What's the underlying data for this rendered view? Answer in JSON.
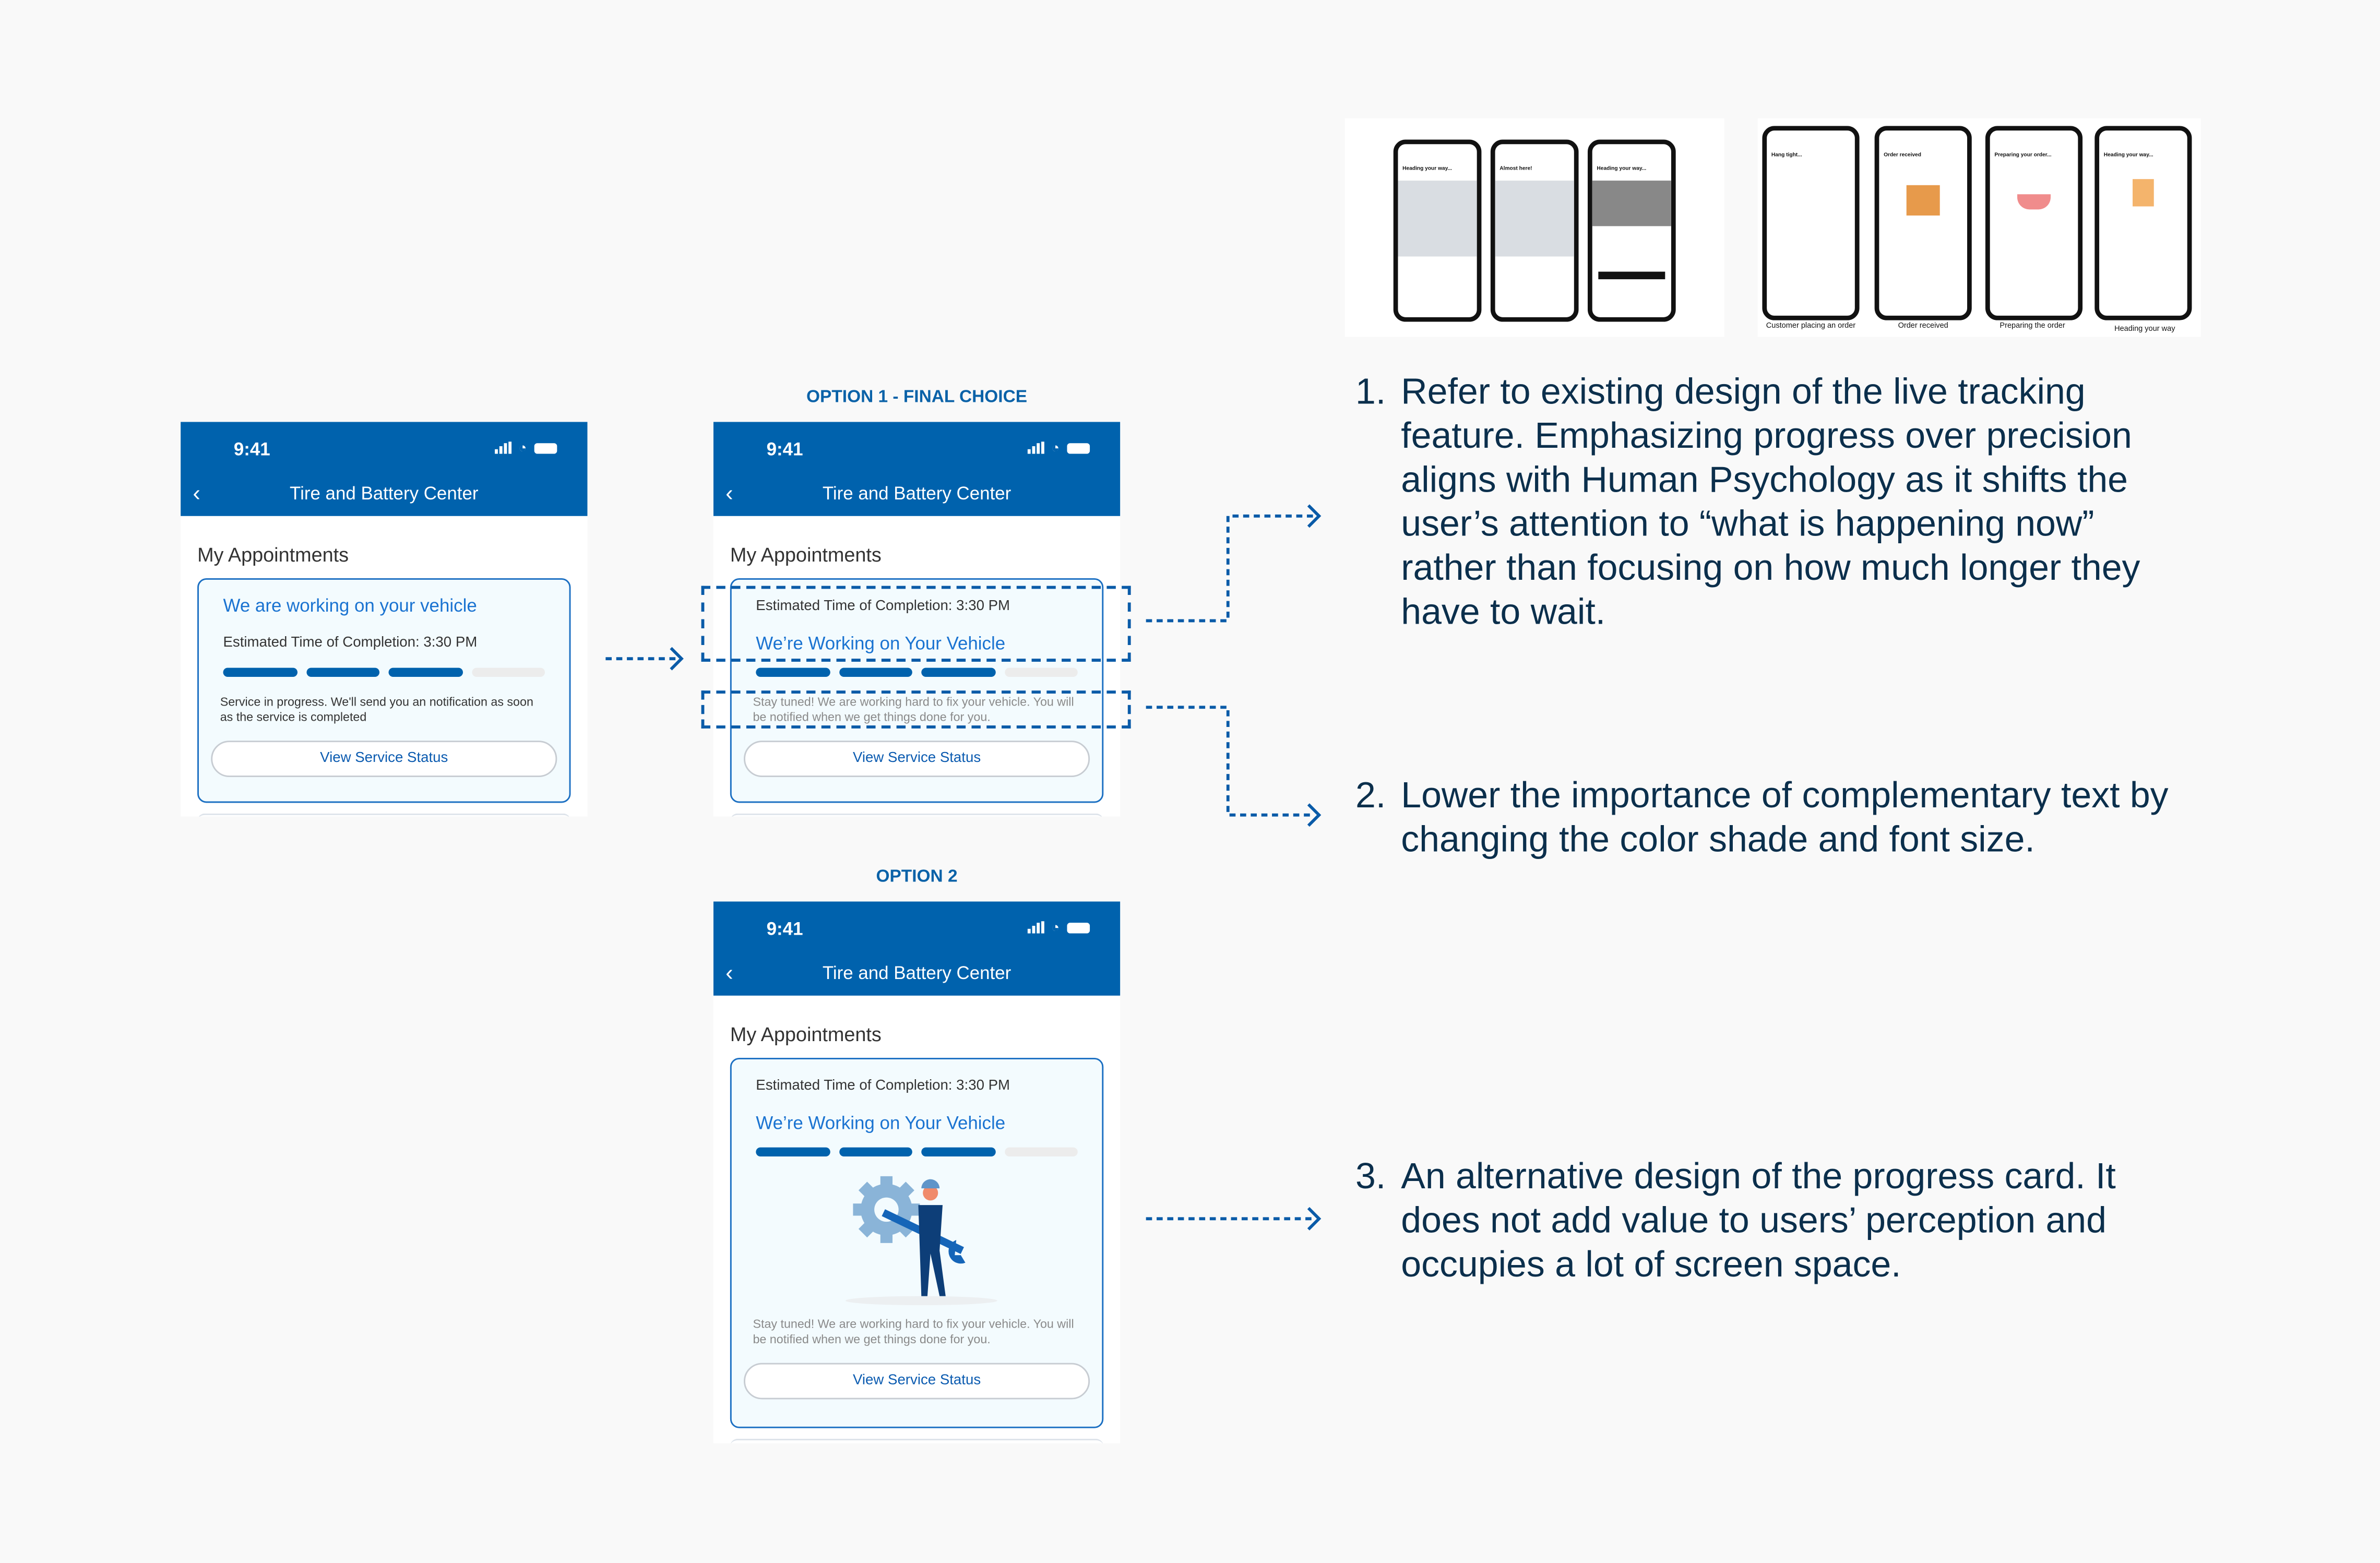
{
  "colors": {
    "brand_blue": "#0062ad",
    "link_blue": "#1a73d1",
    "text_navy": "#0b2f4c",
    "progress_off": "#ececec"
  },
  "phone": {
    "time": "9:41",
    "title": "Tire and Battery Center",
    "section": "My Appointments",
    "back_icon": "chevron-left-icon",
    "status_icons": [
      "signal-icon",
      "wifi-icon",
      "battery-icon"
    ]
  },
  "original": {
    "card_title": "We are working on your vehicle",
    "eta": "Estimated Time of Completion: 3:30 PM",
    "progress": {
      "filled": 3,
      "total": 4
    },
    "note": "Service in progress. We'll send you an notification as soon as the service is completed",
    "button": "View Service Status"
  },
  "option1": {
    "label": "OPTION 1 - FINAL CHOICE",
    "eta": "Estimated Time of Completion: 3:30 PM",
    "card_title": "We’re Working on Your Vehicle",
    "progress": {
      "filled": 3,
      "total": 4
    },
    "note": "Stay tuned! We are working hard to fix your vehicle. You will be notified when we get things done for you.",
    "button": "View Service Status"
  },
  "option2": {
    "label": "OPTION 2",
    "eta": "Estimated Time of Completion: 3:30 PM",
    "card_title": "We’re Working on Your Vehicle",
    "progress": {
      "filled": 3,
      "total": 4
    },
    "illustration": "mechanic-with-wrench-and-gear",
    "note": "Stay tuned! We are working hard to fix your vehicle. You will be notified when we get things done for you.",
    "button": "View Service Status"
  },
  "references": {
    "tracking_screens": [
      "Heading your way...",
      "Almost here!",
      "Heading your way..."
    ],
    "order_screens": [
      {
        "title": "Hang tight...",
        "caption": "Customer placing an order"
      },
      {
        "title": "Order received",
        "caption": "Order received"
      },
      {
        "title": "Preparing your order...",
        "caption": "Preparing the order"
      },
      {
        "title": "Heading your way...",
        "caption": "Heading your way"
      }
    ]
  },
  "notes": [
    {
      "num": "1.",
      "text": "Refer to existing design of the live tracking feature. Emphasizing progress over precision aligns with Human Psychology as it shifts the user’s attention to “what is happening now” rather than focusing on how much longer they have to wait."
    },
    {
      "num": "2.",
      "text": "Lower the importance of complementary text by changing the color shade and font size."
    },
    {
      "num": "3.",
      "text": "An alternative design of the progress card. It does not add value to users’ perception and occupies a lot of screen space."
    }
  ]
}
